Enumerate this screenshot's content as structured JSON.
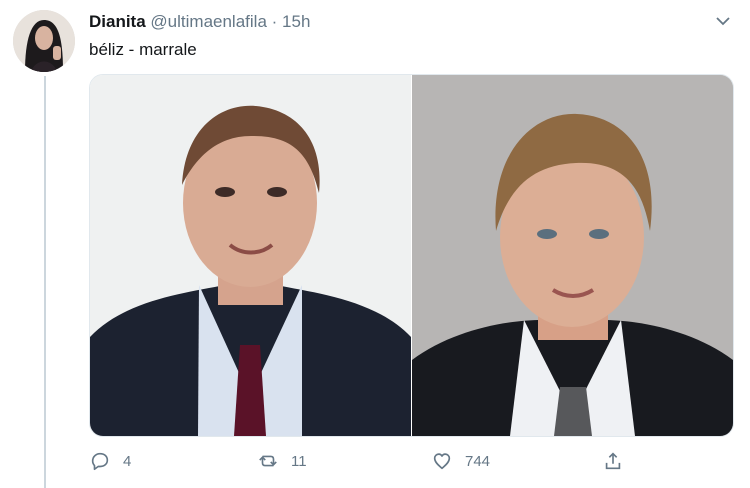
{
  "tweet": {
    "display_name": "Dianita",
    "handle": "@ultimaenlafila",
    "separator": "·",
    "time": "15h",
    "text": "béliz - marrale"
  },
  "actions": {
    "reply_count": "4",
    "retweet_count": "11",
    "like_count": "744"
  },
  "icons": [
    "avatar",
    "chevron-down-icon",
    "reply-icon",
    "retweet-icon",
    "like-icon",
    "share-icon"
  ],
  "colors": {
    "text": "#14171a",
    "secondary": "#657786",
    "thread_line": "#ccd6dd"
  }
}
